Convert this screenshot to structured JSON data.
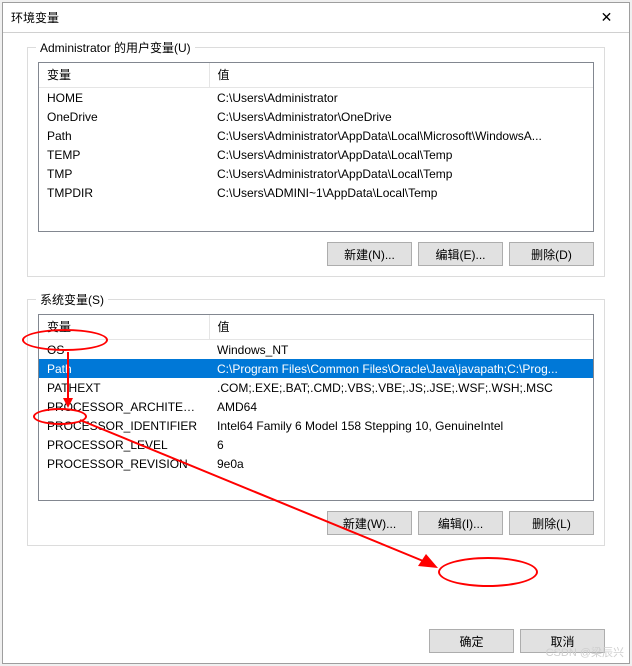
{
  "window": {
    "title": "环境变量"
  },
  "userVars": {
    "legend": "Administrator 的用户变量(U)",
    "headers": {
      "variable": "变量",
      "value": "值"
    },
    "rows": [
      {
        "name": "HOME",
        "value": "C:\\Users\\Administrator"
      },
      {
        "name": "OneDrive",
        "value": "C:\\Users\\Administrator\\OneDrive"
      },
      {
        "name": "Path",
        "value": "C:\\Users\\Administrator\\AppData\\Local\\Microsoft\\WindowsA..."
      },
      {
        "name": "TEMP",
        "value": "C:\\Users\\Administrator\\AppData\\Local\\Temp"
      },
      {
        "name": "TMP",
        "value": "C:\\Users\\Administrator\\AppData\\Local\\Temp"
      },
      {
        "name": "TMPDIR",
        "value": "C:\\Users\\ADMINI~1\\AppData\\Local\\Temp"
      }
    ],
    "buttons": {
      "new": "新建(N)...",
      "edit": "编辑(E)...",
      "delete": "删除(D)"
    }
  },
  "sysVars": {
    "legend": "系统变量(S)",
    "headers": {
      "variable": "变量",
      "value": "值"
    },
    "rows": [
      {
        "name": "OS",
        "value": "Windows_NT"
      },
      {
        "name": "Path",
        "value": "C:\\Program Files\\Common Files\\Oracle\\Java\\javapath;C:\\Prog..."
      },
      {
        "name": "PATHEXT",
        "value": ".COM;.EXE;.BAT;.CMD;.VBS;.VBE;.JS;.JSE;.WSF;.WSH;.MSC"
      },
      {
        "name": "PROCESSOR_ARCHITECT...",
        "value": "AMD64"
      },
      {
        "name": "PROCESSOR_IDENTIFIER",
        "value": "Intel64 Family 6 Model 158 Stepping 10, GenuineIntel"
      },
      {
        "name": "PROCESSOR_LEVEL",
        "value": "6"
      },
      {
        "name": "PROCESSOR_REVISION",
        "value": "9e0a"
      }
    ],
    "selectedIndex": 1,
    "buttons": {
      "new": "新建(W)...",
      "edit": "编辑(I)...",
      "delete": "删除(L)"
    }
  },
  "footer": {
    "ok": "确定",
    "cancel": "取消"
  },
  "watermark": "CSDN @梁辰兴"
}
